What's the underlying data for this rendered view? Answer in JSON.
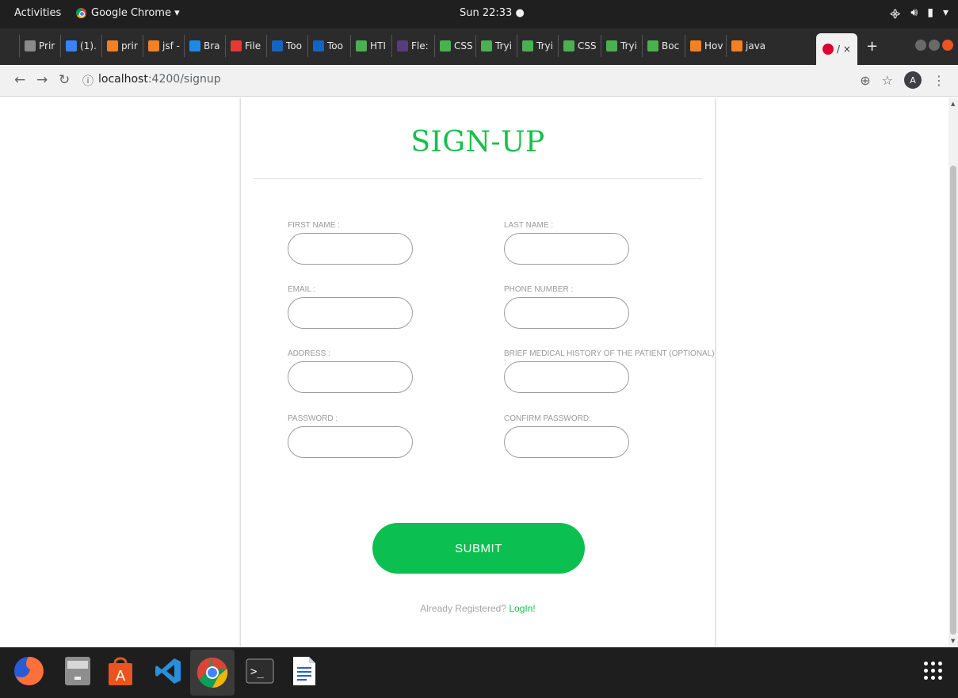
{
  "os_topbar": {
    "activities": "Activities",
    "app_name": "Google Chrome ▾",
    "clock": "Sun 22:33 ●"
  },
  "browser": {
    "tabs": [
      {
        "label": "Prir",
        "color": "#8a8a8a"
      },
      {
        "label": "(1).",
        "color": "#3b82f6"
      },
      {
        "label": "prir",
        "color": "#f48024"
      },
      {
        "label": "jsf -",
        "color": "#f48024"
      },
      {
        "label": "Bra",
        "color": "#1e88e5"
      },
      {
        "label": "File",
        "color": "#e53935"
      },
      {
        "label": "Too",
        "color": "#1565c0"
      },
      {
        "label": "Too",
        "color": "#1565c0"
      },
      {
        "label": "HTI",
        "color": "#4caf50"
      },
      {
        "label": "Fle:",
        "color": "#563d7c"
      },
      {
        "label": "CSS",
        "color": "#4caf50"
      },
      {
        "label": "Tryi",
        "color": "#4caf50"
      },
      {
        "label": "Tryi",
        "color": "#4caf50"
      },
      {
        "label": "CSS",
        "color": "#4caf50"
      },
      {
        "label": "Tryi",
        "color": "#4caf50"
      },
      {
        "label": "Boc",
        "color": "#4caf50"
      },
      {
        "label": "Hov",
        "color": "#f48024"
      },
      {
        "label": "java",
        "color": "#f48024"
      }
    ],
    "active_tab": {
      "label": "/ ×",
      "color": "#dd0031"
    },
    "new_tab": "+",
    "url_host": "localhost",
    "url_path": ":4200/signup",
    "avatar_letter": "A"
  },
  "form": {
    "title": "SIGN-UP",
    "fields": {
      "first_name": "FIRST NAME :",
      "last_name": "LAST NAME :",
      "email": "EMAIL :",
      "phone": "PHONE NUMBER :",
      "address": "ADDRESS :",
      "medical_history": "BRIEF MEDICAL HISTORY OF THE PATIENT (OPTIONAL) :",
      "password": "PASSWORD :",
      "confirm_password": "CONFIRM PASSWORD:"
    },
    "submit_label": "SUBMIT",
    "already_text": "Already Registered?",
    "login_link": "LogIn!",
    "accent_color": "#15c04a"
  },
  "dock": {
    "apps": [
      "firefox-icon",
      "files-icon",
      "software-center-icon",
      "vscode-icon",
      "chrome-icon",
      "terminal-icon",
      "writer-icon",
      "show-apps-icon"
    ]
  }
}
